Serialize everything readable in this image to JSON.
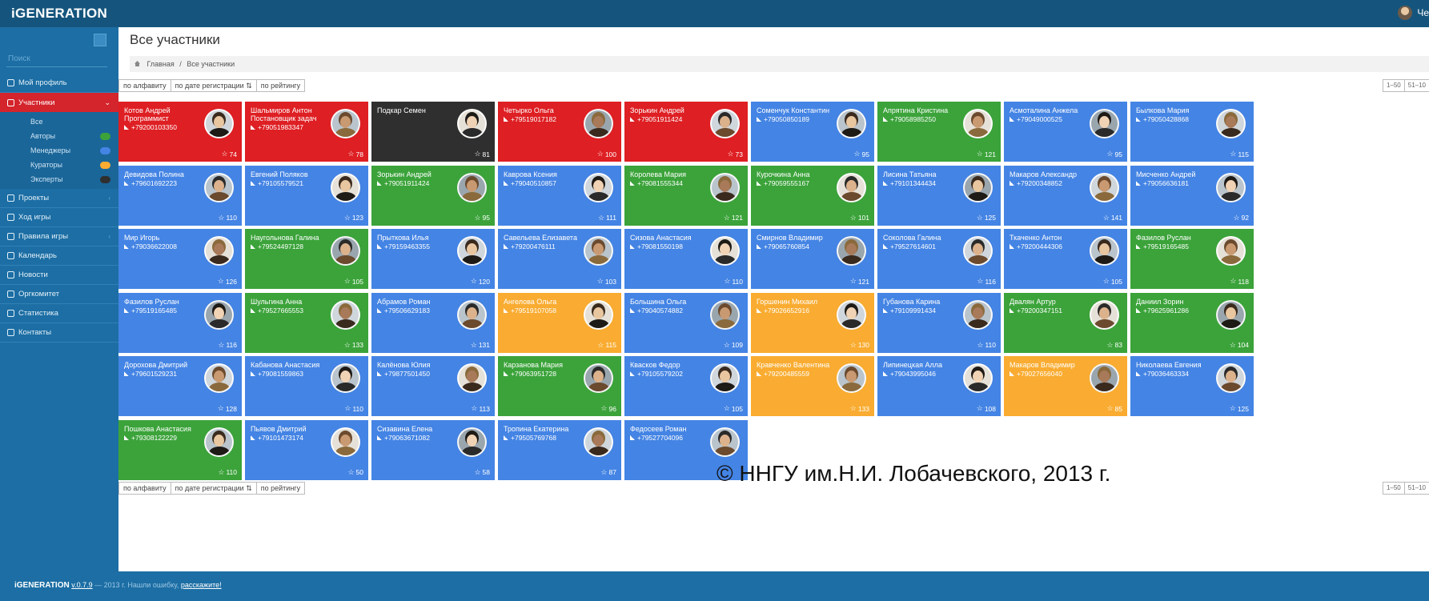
{
  "app": {
    "brand": "iGENERATION",
    "user_name": "Че"
  },
  "sidebar": {
    "search_placeholder": "Поиск",
    "items": [
      {
        "label": "Мой профиль",
        "icon": "user-icon"
      },
      {
        "label": "Участники",
        "icon": "users-icon",
        "active": true
      },
      {
        "label": "Проекты",
        "icon": "projects-icon"
      },
      {
        "label": "Ход игры",
        "icon": "game-icon"
      },
      {
        "label": "Правила игры",
        "icon": "rules-icon"
      },
      {
        "label": "Календарь",
        "icon": "calendar-icon"
      },
      {
        "label": "Новости",
        "icon": "news-icon"
      },
      {
        "label": "Оргкомитет",
        "icon": "org-icon"
      },
      {
        "label": "Статистика",
        "icon": "stats-icon"
      },
      {
        "label": "Контакты",
        "icon": "contacts-icon"
      }
    ],
    "subitems": [
      {
        "label": "Все",
        "color": ""
      },
      {
        "label": "Авторы",
        "color": "#3ba33a"
      },
      {
        "label": "Менеджеры",
        "color": "#4484e4"
      },
      {
        "label": "Кураторы",
        "color": "#f9ac31"
      },
      {
        "label": "Эксперты",
        "color": "#2f2f2f"
      }
    ]
  },
  "main": {
    "title": "Все участники",
    "breadcrumb": {
      "home": "Главная",
      "sep": "/",
      "current": "Все участники"
    },
    "sort": [
      "по алфавиту",
      "по дате регистрации ⇅",
      "по рейтингу"
    ],
    "pager": [
      "1–50",
      "51–10"
    ]
  },
  "colors": {
    "blue": "#4484e4",
    "red": "#de1f23",
    "green": "#3ba33a",
    "orange": "#f9ac31",
    "black": "#2f2f2f"
  },
  "cards": [
    {
      "name": "Котов Андрей Программист",
      "phone": "+79200103350",
      "score": "74",
      "color": "red"
    },
    {
      "name": "Шальмиров Антон Постановщик задач",
      "phone": "+79051983347",
      "score": "78",
      "color": "red"
    },
    {
      "name": "Подкар Семен",
      "phone": "",
      "score": "81",
      "color": "black"
    },
    {
      "name": "Четырко Ольга",
      "phone": "+79519017182",
      "score": "100",
      "color": "red"
    },
    {
      "name": "Зорькин Андрей",
      "phone": "+79051911424",
      "score": "73",
      "color": "red"
    },
    {
      "name": "Соменчук Константин",
      "phone": "+79050850189",
      "score": "95",
      "color": "blue"
    },
    {
      "name": "Апрятина Кристина",
      "phone": "+79058985250",
      "score": "121",
      "color": "green"
    },
    {
      "name": "Асмоталина Анжела",
      "phone": "+79049000525",
      "score": "95",
      "color": "blue"
    },
    {
      "name": "Былкова Мария",
      "phone": "+79050428868",
      "score": "115",
      "color": "blue"
    },
    {
      "name": "Девидова Полина",
      "phone": "+79601692223",
      "score": "110",
      "color": "blue"
    },
    {
      "name": "Евгений Поляков",
      "phone": "+79105579521",
      "score": "123",
      "color": "blue"
    },
    {
      "name": "Зорькин Андрей",
      "phone": "+79051911424",
      "score": "95",
      "color": "green"
    },
    {
      "name": "Каврова Ксения",
      "phone": "+79040510857",
      "score": "111",
      "color": "blue"
    },
    {
      "name": "Королева Мария",
      "phone": "+79081555344",
      "score": "121",
      "color": "green"
    },
    {
      "name": "Курочкина Анна",
      "phone": "+79059555167",
      "score": "101",
      "color": "green"
    },
    {
      "name": "Лисина Татьяна",
      "phone": "+79101344434",
      "score": "125",
      "color": "blue"
    },
    {
      "name": "Макаров Александр",
      "phone": "+79200348852",
      "score": "141",
      "color": "blue"
    },
    {
      "name": "Мисченко Андрей",
      "phone": "+79056636181",
      "score": "92",
      "color": "blue"
    },
    {
      "name": "Мир Игорь",
      "phone": "+79036622008",
      "score": "126",
      "color": "blue"
    },
    {
      "name": "Наугольнова Галина",
      "phone": "+79524497128",
      "score": "105",
      "color": "green"
    },
    {
      "name": "Прыткова Илья",
      "phone": "+79159463355",
      "score": "120",
      "color": "blue"
    },
    {
      "name": "Савельева Елизавета",
      "phone": "+79200476111",
      "score": "103",
      "color": "blue"
    },
    {
      "name": "Сизова Анастасия",
      "phone": "+79081550198",
      "score": "110",
      "color": "blue"
    },
    {
      "name": "Смирнов Владимир",
      "phone": "+79065760854",
      "score": "121",
      "color": "blue"
    },
    {
      "name": "Соколова Галина",
      "phone": "+79527614601",
      "score": "116",
      "color": "blue"
    },
    {
      "name": "Ткаченко Антон",
      "phone": "+79200444306",
      "score": "105",
      "color": "blue"
    },
    {
      "name": "Фазилов Руслан",
      "phone": "+79519165485",
      "score": "118",
      "color": "green"
    },
    {
      "name": "Фазилов Руслан",
      "phone": "+79519165485",
      "score": "116",
      "color": "blue"
    },
    {
      "name": "Шульгина Анна",
      "phone": "+79527665553",
      "score": "133",
      "color": "green"
    },
    {
      "name": "Абрамов Роман",
      "phone": "+79506629183",
      "score": "131",
      "color": "blue"
    },
    {
      "name": "Ангелова Ольга",
      "phone": "+79519107058",
      "score": "115",
      "color": "orange"
    },
    {
      "name": "Большина Ольга",
      "phone": "+79040574882",
      "score": "109",
      "color": "blue"
    },
    {
      "name": "Горшенин Михаил",
      "phone": "+79026652916",
      "score": "130",
      "color": "orange"
    },
    {
      "name": "Губанова Карина",
      "phone": "+79109991434",
      "score": "110",
      "color": "blue"
    },
    {
      "name": "Двалян Артур",
      "phone": "+79200347151",
      "score": "83",
      "color": "green"
    },
    {
      "name": "Даниил Зорин",
      "phone": "+79625961286",
      "score": "104",
      "color": "green"
    },
    {
      "name": "Дорохова Дмитрий",
      "phone": "+79601529231",
      "score": "128",
      "color": "blue"
    },
    {
      "name": "Кабанова Анастасия",
      "phone": "+79081559863",
      "score": "110",
      "color": "blue"
    },
    {
      "name": "Калёнова Юлия",
      "phone": "+79877501450",
      "score": "113",
      "color": "blue"
    },
    {
      "name": "Карзанова Мария",
      "phone": "+79063951728",
      "score": "96",
      "color": "green"
    },
    {
      "name": "Квасков Федор",
      "phone": "+79105579202",
      "score": "105",
      "color": "blue"
    },
    {
      "name": "Кравченко Валентина",
      "phone": "+79200485559",
      "score": "133",
      "color": "orange"
    },
    {
      "name": "Липинецкая Алла",
      "phone": "+79043995046",
      "score": "108",
      "color": "blue"
    },
    {
      "name": "Макаров Владимир",
      "phone": "+79027656040",
      "score": "85",
      "color": "orange"
    },
    {
      "name": "Николаева Евгения",
      "phone": "+79036463334",
      "score": "125",
      "color": "blue"
    },
    {
      "name": "Пошкова Анастасия",
      "phone": "+79308122229",
      "score": "110",
      "color": "green"
    },
    {
      "name": "Пьявов Дмитрий",
      "phone": "+79101473174",
      "score": "50",
      "color": "blue"
    },
    {
      "name": "Сизавина Елена",
      "phone": "+79063671082",
      "score": "58",
      "color": "blue"
    },
    {
      "name": "Тропина Екатерина",
      "phone": "+79505769768",
      "score": "87",
      "color": "blue"
    },
    {
      "name": "Федосеев Роман",
      "phone": "+79527704096",
      "score": "",
      "color": "blue"
    }
  ],
  "copyright": "© ННГУ им.Н.И. Лобачевского, 2013 г.",
  "footer": {
    "brand": "iGENERATION",
    "version": "v.0.7.9",
    "text": "— 2013 г.   Нашли ошибку,",
    "link": "расскажите!"
  }
}
